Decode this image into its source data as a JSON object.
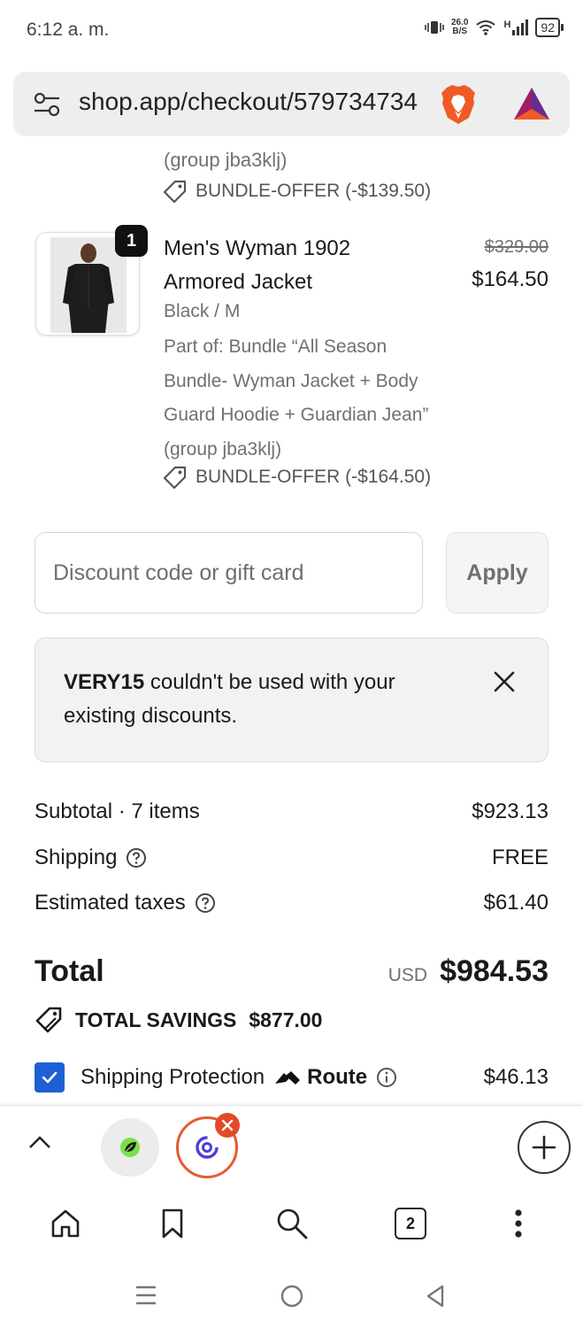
{
  "status_bar": {
    "time": "6:12 a. m.",
    "net_speed_value": "26.0",
    "net_speed_unit": "B/S",
    "signal_label": "H",
    "battery": "92"
  },
  "browser": {
    "url": "shop.app/checkout/579734734"
  },
  "previous_item": {
    "group_text": "(group jba3klj)",
    "offer_text": "BUNDLE-OFFER (-$139.50)"
  },
  "line_item": {
    "quantity": "1",
    "name": "Men's Wyman 1902 Armored Jacket",
    "original_price": "$329.00",
    "price": "$164.50",
    "variant": "Black / M",
    "bundle_text": "Part of: Bundle “All Season Bundle- Wyman Jacket + Body Guard Hoodie + Guardian Jean”",
    "group_text": "(group jba3klj)",
    "offer_text": "BUNDLE-OFFER (-$164.50)"
  },
  "discount": {
    "placeholder": "Discount code or gift card",
    "apply_label": "Apply"
  },
  "notice": {
    "code": "VERY15",
    "message": " couldn't be used with your existing discounts."
  },
  "summary": {
    "subtotal_label": "Subtotal · 7 items",
    "subtotal_value": "$923.13",
    "shipping_label": "Shipping",
    "shipping_value": "FREE",
    "taxes_label": "Estimated taxes",
    "taxes_value": "$61.40",
    "total_label": "Total",
    "currency": "USD",
    "total_value": "$984.53",
    "savings_label": "TOTAL SAVINGS",
    "savings_value": "$877.00",
    "protection_label": "Shipping Protection",
    "route_label": "Route",
    "protection_value": "$46.13"
  },
  "toolbar": {
    "tab_count": "2"
  },
  "colors": {
    "accent_blue": "#1f5fd6",
    "tab_ring": "#e55b34",
    "close_badge": "#e24a2a"
  }
}
